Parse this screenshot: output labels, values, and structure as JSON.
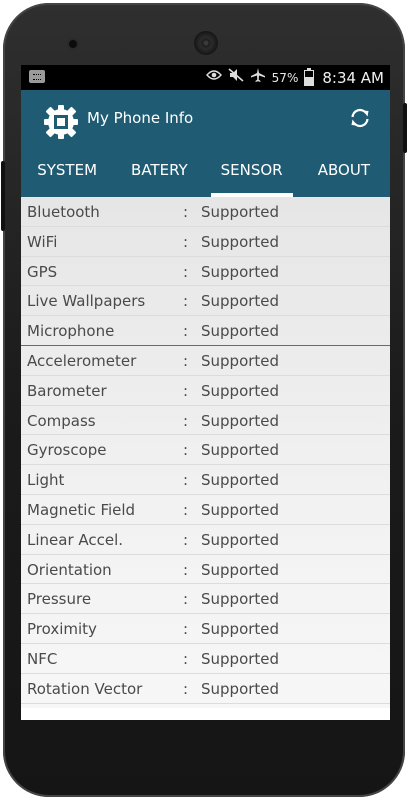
{
  "status_bar": {
    "battery_percent": "57%",
    "time": "8:34 AM",
    "icons": [
      "notification-icon",
      "eye-icon",
      "mute-icon",
      "airplane-icon",
      "battery-icon"
    ]
  },
  "app": {
    "title": "My Phone Info",
    "logo_icon": "chip-gear-icon",
    "refresh_icon": "refresh-icon",
    "colors": {
      "appbar": "#1f5c73",
      "tab_indicator": "#ffffff"
    }
  },
  "tabs": [
    {
      "label": "SYSTEM",
      "active": false
    },
    {
      "label": "BATERY",
      "active": false
    },
    {
      "label": "SENSOR",
      "active": true
    },
    {
      "label": "ABOUT",
      "active": false
    }
  ],
  "features": [
    {
      "name": "Bluetooth",
      "sep": ":",
      "value": "Supported"
    },
    {
      "name": "WiFi",
      "sep": ":",
      "value": "Supported"
    },
    {
      "name": "GPS",
      "sep": ":",
      "value": "Supported"
    },
    {
      "name": "Live Wallpapers",
      "sep": ":",
      "value": "Supported"
    },
    {
      "name": "Microphone",
      "sep": ":",
      "value": "Supported"
    },
    {
      "name": "Accelerometer",
      "sep": ":",
      "value": "Supported"
    },
    {
      "name": "Barometer",
      "sep": ":",
      "value": "Supported"
    },
    {
      "name": "Compass",
      "sep": ":",
      "value": "Supported"
    },
    {
      "name": "Gyroscope",
      "sep": ":",
      "value": "Supported"
    },
    {
      "name": "Light",
      "sep": ":",
      "value": "Supported"
    },
    {
      "name": "Magnetic Field",
      "sep": ":",
      "value": "Supported"
    },
    {
      "name": "Linear Accel.",
      "sep": ":",
      "value": "Supported"
    },
    {
      "name": "Orientation",
      "sep": ":",
      "value": "Supported"
    },
    {
      "name": "Pressure",
      "sep": ":",
      "value": "Supported"
    },
    {
      "name": "Proximity",
      "sep": ":",
      "value": "Supported"
    },
    {
      "name": "NFC",
      "sep": ":",
      "value": "Supported"
    },
    {
      "name": "Rotation Vector",
      "sep": ":",
      "value": "Supported"
    }
  ]
}
